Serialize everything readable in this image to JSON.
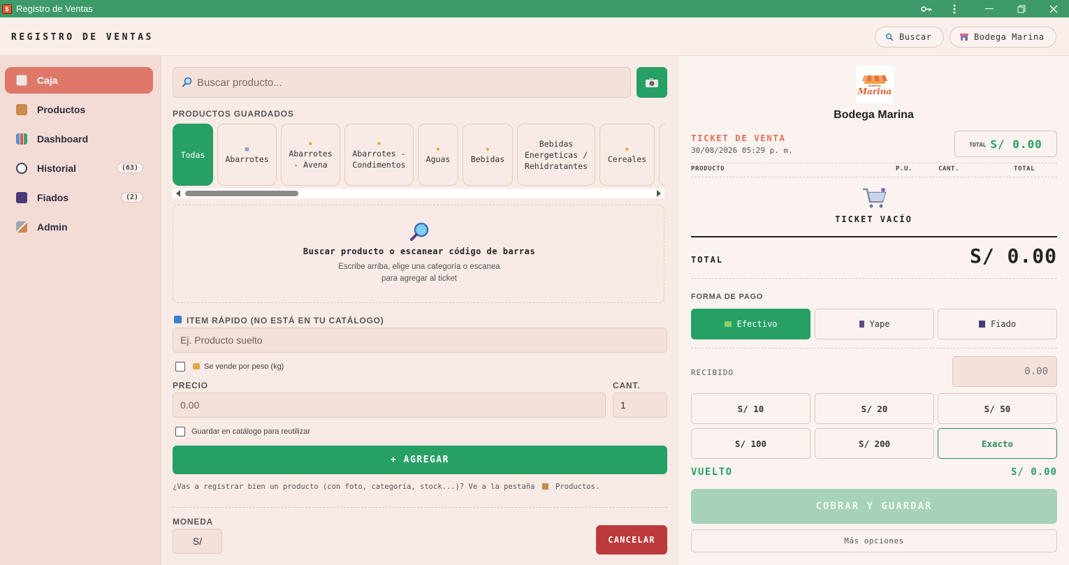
{
  "window": {
    "title": "Registro de Ventas",
    "app_icon": "app-logo-icon"
  },
  "header": {
    "title": "REGISTRO DE VENTAS",
    "search_label": "Buscar",
    "store_label": "Bodega Marina"
  },
  "sidebar": {
    "items": [
      {
        "label": "Caja",
        "icon": "receipt-icon",
        "active": true
      },
      {
        "label": "Productos",
        "icon": "package-icon"
      },
      {
        "label": "Dashboard",
        "icon": "bar-chart-icon"
      },
      {
        "label": "Historial",
        "icon": "clock-icon",
        "badge": "(63)"
      },
      {
        "label": "Fiados",
        "icon": "notebook-icon",
        "badge": "(2)"
      },
      {
        "label": "Admin",
        "icon": "tools-icon"
      }
    ]
  },
  "center": {
    "search_placeholder": "Buscar producto...",
    "saved_products_label": "PRODUCTOS GUARDADOS",
    "categories": [
      "Todas",
      "Abarrotes",
      "Abarrotes - Avena",
      "Abarrotes - Condimentos",
      "Aguas",
      "Bebidas",
      "Bebidas Energeticas / Rehidratantes",
      "Cereales"
    ],
    "empty_title": "Buscar producto o escanear código de barras",
    "empty_line1": "Escribe arriba, elige una categoría o escanea",
    "empty_line2": "para agregar al ticket",
    "quick_item_label": "ITEM RÁPIDO (NO ESTÁ EN TU CATÁLOGO)",
    "quick_item_placeholder": "Ej. Producto suelto",
    "by_weight_label": "Se vende por peso (kg)",
    "price_label": "PRECIO",
    "price_placeholder": "0.00",
    "qty_label": "CANT.",
    "qty_value": "1",
    "save_catalog_label": "Guardar en catálogo para reutilizar",
    "add_button": "+ AGREGAR",
    "hint_text": "¿Vas a registrar bien un producto (con foto, categoría, stock...)? Ve a la pestaña",
    "hint_link": "Productos.",
    "currency_label": "MONEDA",
    "currency_value": "S/",
    "cancel_button": "CANCELAR"
  },
  "ticket": {
    "store_name": "Bodega Marina",
    "logo_text_top": "BODEGA",
    "logo_text": "Marina",
    "title": "TICKET DE VENTA",
    "datetime": "30/08/2026 05:29 p. m.",
    "total_chip_label": "TOTAL",
    "total_chip_value": "S/ 0.00",
    "columns": [
      "PRODUCTO",
      "P.U.",
      "CANT.",
      "TOTAL"
    ],
    "empty_label": "TICKET VACÍO",
    "total_label": "TOTAL",
    "total_value": "S/ 0.00",
    "payment_label": "FORMA DE PAGO",
    "payment_methods": [
      "Efectivo",
      "Yape",
      "Fiado"
    ],
    "received_label": "RECIBIDO",
    "received_placeholder": "0.00",
    "quick_amounts": [
      "S/ 10",
      "S/ 20",
      "S/ 50",
      "S/ 100",
      "S/ 200",
      "Exacto"
    ],
    "change_label": "VUELTO",
    "change_value": "S/ 0.00",
    "charge_button": "COBRAR Y GUARDAR",
    "more_options": "Más opciones"
  },
  "colors": {
    "titlebar": "#3e9a69",
    "primary_green": "#27a066",
    "active_nav": "#df7868",
    "cancel_red": "#bd3a3c",
    "ticket_title": "#e2715a",
    "charge_disabled": "#a5d2b8"
  }
}
